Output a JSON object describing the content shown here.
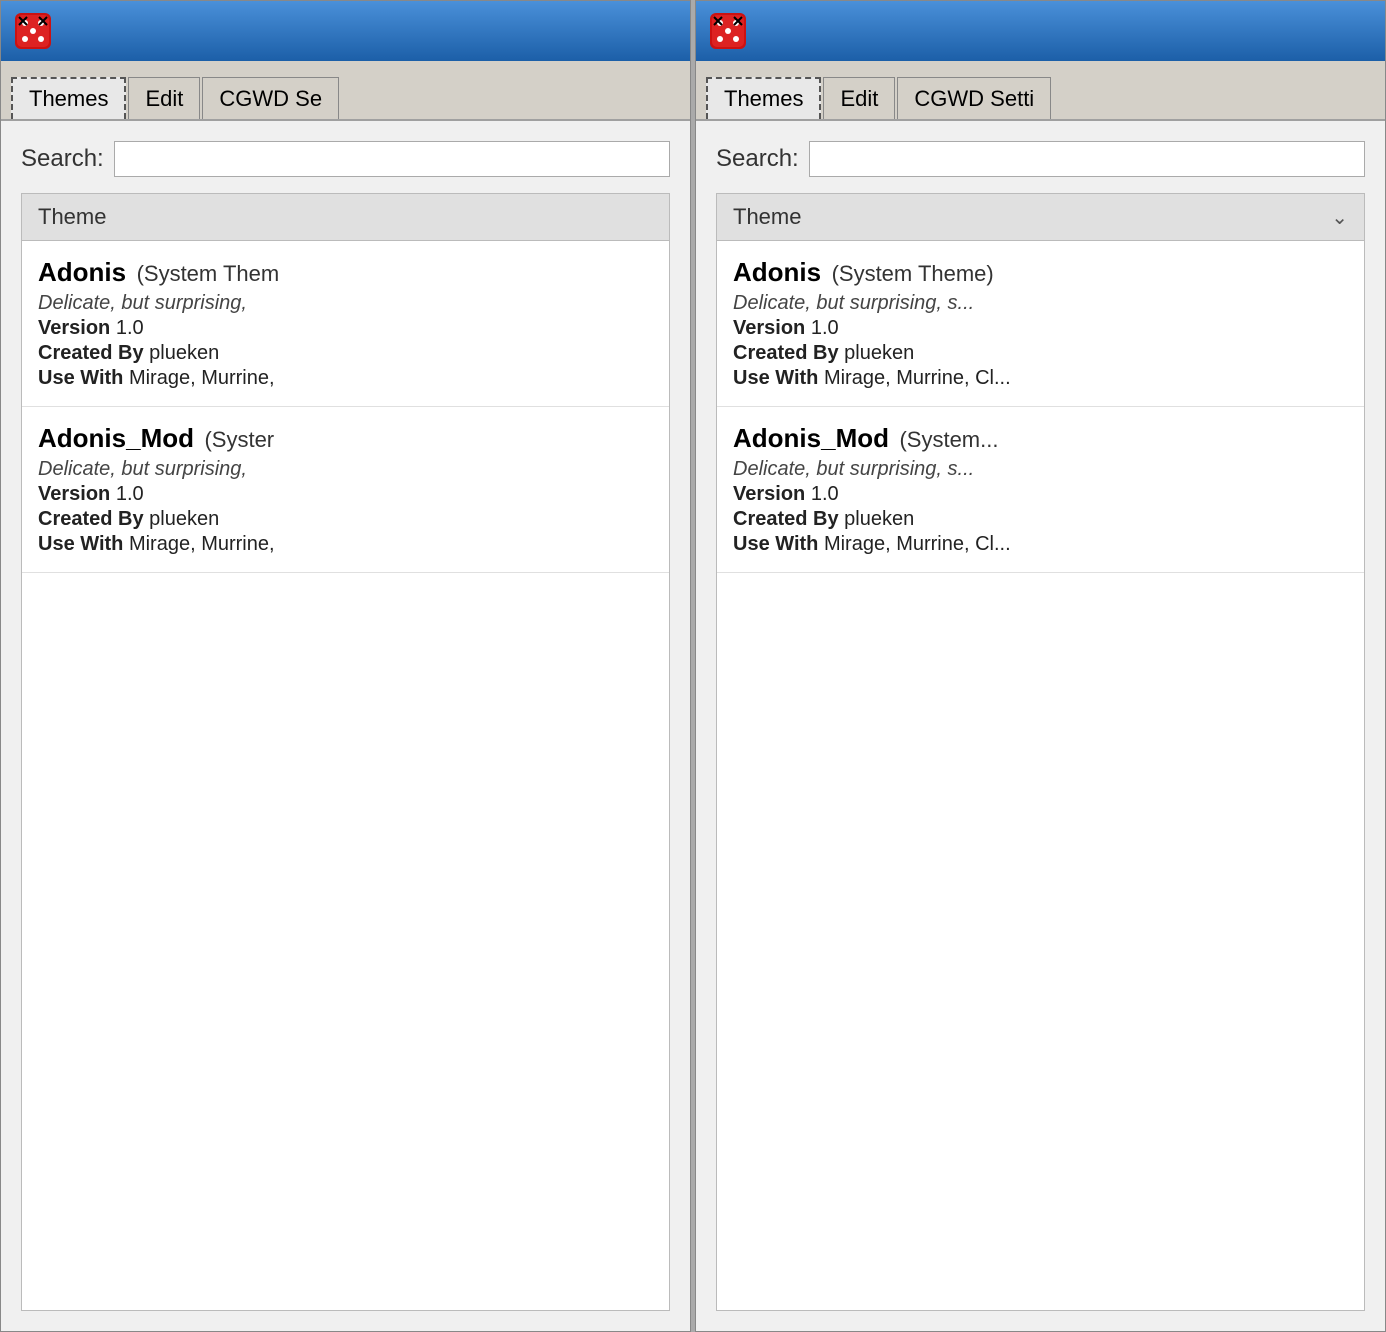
{
  "window1": {
    "titlebar": {
      "icon": "dice-icon"
    },
    "menubar": {
      "items": [
        {
          "label": "Themes",
          "active": true
        },
        {
          "label": "Edit",
          "active": false
        },
        {
          "label": "CGWD Se",
          "active": false
        }
      ]
    },
    "search": {
      "label": "Search:",
      "placeholder": ""
    },
    "table": {
      "header": "Theme",
      "items": [
        {
          "name": "Adonis",
          "type": "(System Them",
          "desc": "Delicate, but surprising,",
          "version": "1.0",
          "created_by": "plueken",
          "use_with": "Mirage, Murrine,"
        },
        {
          "name": "Adonis_Mod",
          "type": "(Syster",
          "desc": "Delicate, but surprising,",
          "version": "1.0",
          "created_by": "plueken",
          "use_with": "Mirage, Murrine,"
        }
      ]
    }
  },
  "window2": {
    "titlebar": {
      "icon": "dice-icon"
    },
    "menubar": {
      "items": [
        {
          "label": "Themes",
          "active": true
        },
        {
          "label": "Edit",
          "active": false
        },
        {
          "label": "CGWD Setti",
          "active": false
        }
      ]
    },
    "search": {
      "label": "Search:",
      "placeholder": ""
    },
    "table": {
      "header": "Theme",
      "has_chevron": true,
      "items": [
        {
          "name": "Adonis",
          "type": "(System Theme)",
          "desc": "Delicate, but surprising, s...",
          "version": "1.0",
          "created_by": "plueken",
          "use_with": "Mirage, Murrine, Cl..."
        },
        {
          "name": "Adonis_Mod",
          "type": "(System...",
          "desc": "Delicate, but surprising, s...",
          "version": "1.0",
          "created_by": "plueken",
          "use_with": "Mirage, Murrine, Cl..."
        }
      ]
    }
  },
  "labels": {
    "version_prefix": "Version",
    "created_by_prefix": "Created By",
    "use_with_prefix": "Use With"
  }
}
